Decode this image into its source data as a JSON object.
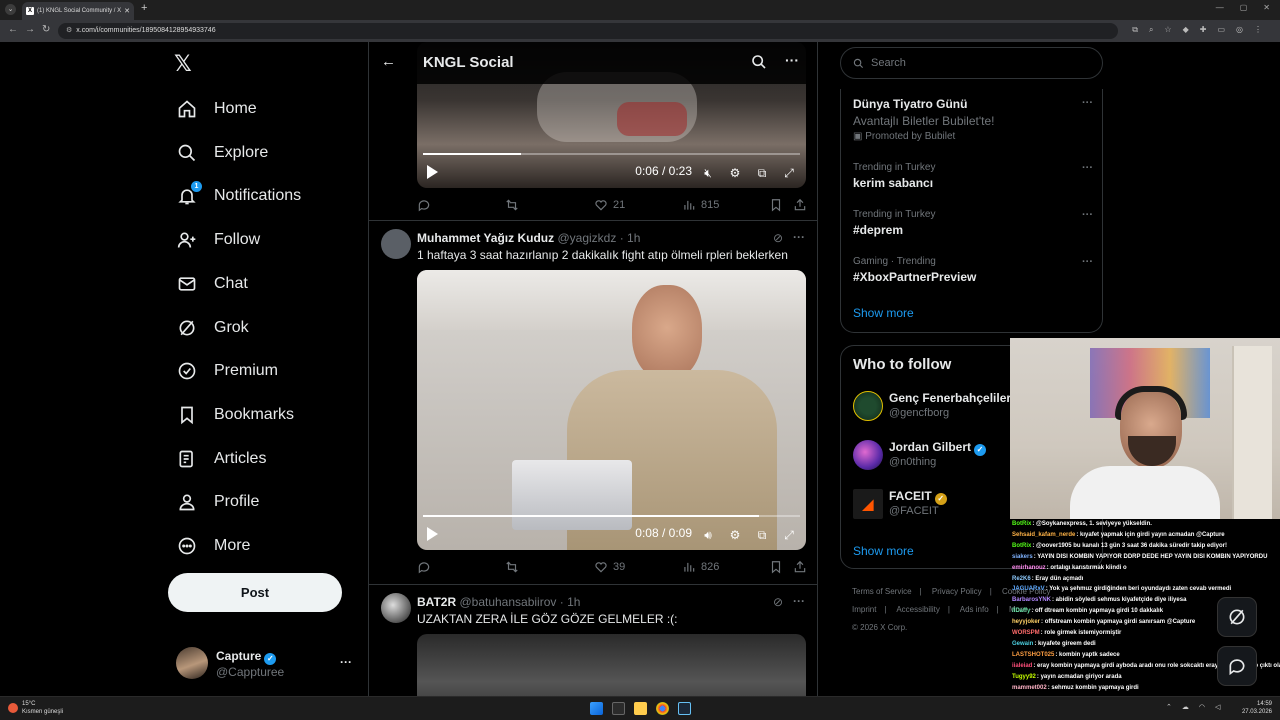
{
  "browser": {
    "tab_title": "(1) KNGL Social Community / X",
    "url": "x.com/i/communities/1895084128954933746"
  },
  "nav": {
    "items": [
      {
        "label": "Home",
        "icon": "home-icon"
      },
      {
        "label": "Explore",
        "icon": "search-icon"
      },
      {
        "label": "Notifications",
        "icon": "bell-icon",
        "badge": "1"
      },
      {
        "label": "Follow",
        "icon": "person-add-icon"
      },
      {
        "label": "Chat",
        "icon": "mail-icon"
      },
      {
        "label": "Grok",
        "icon": "grok-icon"
      },
      {
        "label": "Premium",
        "icon": "premium-icon"
      },
      {
        "label": "Bookmarks",
        "icon": "bookmark-icon"
      },
      {
        "label": "Articles",
        "icon": "articles-icon"
      },
      {
        "label": "Profile",
        "icon": "profile-icon"
      },
      {
        "label": "More",
        "icon": "more-circle-icon"
      }
    ],
    "post_label": "Post",
    "user": {
      "name": "Capture",
      "handle": "@Cappturee"
    }
  },
  "main": {
    "title": "KNGL Social",
    "top_video": {
      "time": "0:06 / 0:23",
      "progress": 0.26
    },
    "top_actions": {
      "likes": "21",
      "views": "815"
    },
    "tweets": [
      {
        "name": "Muhammet Yağız Kuduz",
        "handle": "@yagizkdz",
        "time": "1h",
        "text": "1 haftaya 3 saat hazırlanıp 2 dakikalık fight atıp ölmeli rpleri beklerken",
        "video": {
          "time": "0:08 / 0:09",
          "progress": 0.89
        },
        "likes": "39",
        "views": "826"
      },
      {
        "name": "BAT2R",
        "handle": "@batuhansabiirov",
        "time": "1h",
        "text": "UZAKTAN ZERA İLE GÖZ GÖZE GELMELER :(:"
      }
    ]
  },
  "right": {
    "search_placeholder": "Search",
    "trends": [
      {
        "name": "Dünya Tiyatro Günü",
        "sub": "Avantajlı Biletler Bubilet'te!",
        "promo": "Promoted by Bubilet"
      },
      {
        "context": "Trending in Turkey",
        "name": "kerim sabancı"
      },
      {
        "context": "Trending in Turkey",
        "name": "#deprem"
      },
      {
        "context": "Gaming · Trending",
        "name": "#XboxPartnerPreview"
      }
    ],
    "show_more": "Show more",
    "wtf_title": "Who to follow",
    "follows": [
      {
        "name": "Genç Fenerbahçeliler",
        "handle": "@gencfborg",
        "badge": "blue"
      },
      {
        "name": "Jordan Gilbert",
        "handle": "@n0thing",
        "badge": "blue"
      },
      {
        "name": "FACEIT",
        "handle": "@FACEIT",
        "badge": "gold"
      }
    ],
    "footer": [
      "Terms of Service",
      "Privacy Policy",
      "Cookie Policy",
      "Imprint",
      "Accessibility",
      "Ads info",
      "More ···",
      "© 2026 X Corp."
    ]
  },
  "chat": {
    "lines": [
      {
        "user": "BotRix",
        "color": "#53fc18",
        "text": ": @Soykanexpress, 1. seviyeye yükseldin."
      },
      {
        "user": "Sehsaid_kafam_nerde",
        "color": "#ffb347",
        "text": ": kıyafet yapmak için girdi yayın acmadan @Capture"
      },
      {
        "user": "BotRix",
        "color": "#53fc18",
        "text": ": @oover1905 bu kanalı 13 gün 3 saat 36 dakika süredir takip ediyor!"
      },
      {
        "user": "siakers",
        "color": "#7fb3ff",
        "text": ": YAYIN DISI KOMBIN YAPIYOR DDRP DEDE HEP YAYIN DISI KOMBIN YAPIYORDU"
      },
      {
        "user": "emirhanouz",
        "color": "#ff8cf0",
        "text": ": ortalıgı karıstırmak kiindi o"
      },
      {
        "user": "Re2K6",
        "color": "#8ecbff",
        "text": ": Eray dün açmadı"
      },
      {
        "user": "JAGUARxV",
        "color": "#5da9ff",
        "text": ": Yok ya şehmuz girdiğinden beri oyundaydı zaten cevab vermedi"
      },
      {
        "user": "BarbarosYNK",
        "color": "#b388ff",
        "text": ": abidin söyledi sehmus kiyafetçide diye iliyesa"
      },
      {
        "user": "IIDaffy",
        "color": "#66e0a3",
        "text": ": off dtream kombin yapmaya girdi 10 dakkalık"
      },
      {
        "user": "heyyjoker",
        "color": "#ffd166",
        "text": ": offstream kombin yapmaya girdi sanırsam @Capture"
      },
      {
        "user": "WORSPM",
        "color": "#ff6b6b",
        "text": ": role girmek istemiyormiştir"
      },
      {
        "user": "Gewain",
        "color": "#4dd0e1",
        "text": ": kıyafete gireem dedi"
      },
      {
        "user": "LASTSHOT025",
        "color": "#ff9f43",
        "text": ": kombin yaptk sadece"
      },
      {
        "user": "iialeiad",
        "color": "#ff4f7b",
        "text": ": eray kombin yapmaya girdi ayboda aradı onu role sokcaktı eray geliyom diyip çıktı olay bu bişiyok @Capture"
      },
      {
        "user": "Tugyy92",
        "color": "#c6ff00",
        "text": ": yayın acmadan giriyor arada"
      },
      {
        "user": "mammet002",
        "color": "#ffb3c6",
        "text": ": sehmuz kombin yapmaya girdi"
      }
    ]
  },
  "taskbar": {
    "weather_temp": "15°C",
    "weather_desc": "Kısmen güneşli",
    "time": "14:59",
    "date": "27.03.2026"
  },
  "colors": {
    "accent": "#1d9bf0",
    "bg": "#000000",
    "muted": "#71767b",
    "border": "#2f3336"
  }
}
